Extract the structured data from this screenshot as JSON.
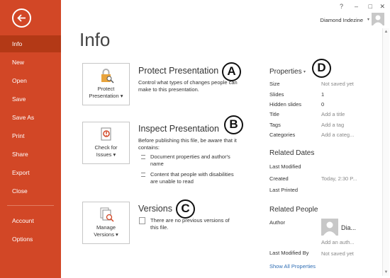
{
  "window": {
    "help": "?",
    "minimize": "–",
    "restore": "□",
    "close": "✕",
    "user_name": "Diamond Indezine",
    "user_caret": "▾"
  },
  "sidebar": {
    "items": [
      {
        "label": "Info",
        "active": true
      },
      {
        "label": "New"
      },
      {
        "label": "Open"
      },
      {
        "label": "Save"
      },
      {
        "label": "Save As"
      },
      {
        "label": "Print"
      },
      {
        "label": "Share"
      },
      {
        "label": "Export"
      },
      {
        "label": "Close"
      },
      {
        "label": "Account"
      },
      {
        "label": "Options"
      }
    ]
  },
  "page": {
    "title": "Info"
  },
  "protect": {
    "button_line1": "Protect",
    "button_line2": "Presentation ▾",
    "title": "Protect Presentation",
    "desc": "Control what types of changes people can make to this presentation.",
    "callout": "A"
  },
  "inspect": {
    "button_line1": "Check for",
    "button_line2": "Issues ▾",
    "title": "Inspect Presentation",
    "desc": "Before publishing this file, be aware that it contains:",
    "bullets": [
      "Document properties and author's name",
      "Content that people with disabilities are unable to read"
    ],
    "callout": "B"
  },
  "versions": {
    "button_line1": "Manage",
    "button_line2": "Versions ▾",
    "title": "Versions",
    "desc": "There are no previous versions of this file.",
    "callout": "C"
  },
  "properties": {
    "title": "Properties",
    "caret": "▾",
    "callout": "D",
    "rows": [
      {
        "label": "Size",
        "value": "Not saved yet",
        "muted": true
      },
      {
        "label": "Slides",
        "value": "1",
        "muted": false
      },
      {
        "label": "Hidden slides",
        "value": "0",
        "muted": false
      },
      {
        "label": "Title",
        "value": "Add a title",
        "muted": true
      },
      {
        "label": "Tags",
        "value": "Add a tag",
        "muted": true
      },
      {
        "label": "Categories",
        "value": "Add a categ...",
        "muted": true
      }
    ]
  },
  "related_dates": {
    "title": "Related Dates",
    "rows": [
      {
        "label": "Last Modified",
        "value": ""
      },
      {
        "label": "Created",
        "value": "Today, 2:30 P..."
      },
      {
        "label": "Last Printed",
        "value": ""
      }
    ]
  },
  "related_people": {
    "title": "Related People",
    "author_label": "Author",
    "author_name": "Dia...",
    "add_author": "Add an auth...",
    "last_modified_by_label": "Last Modified By",
    "last_modified_by_value": "Not saved yet",
    "show_all": "Show All Properties"
  },
  "colors": {
    "sidebar": "#D24726",
    "active": "#B33916",
    "link": "#2E6DB4"
  }
}
